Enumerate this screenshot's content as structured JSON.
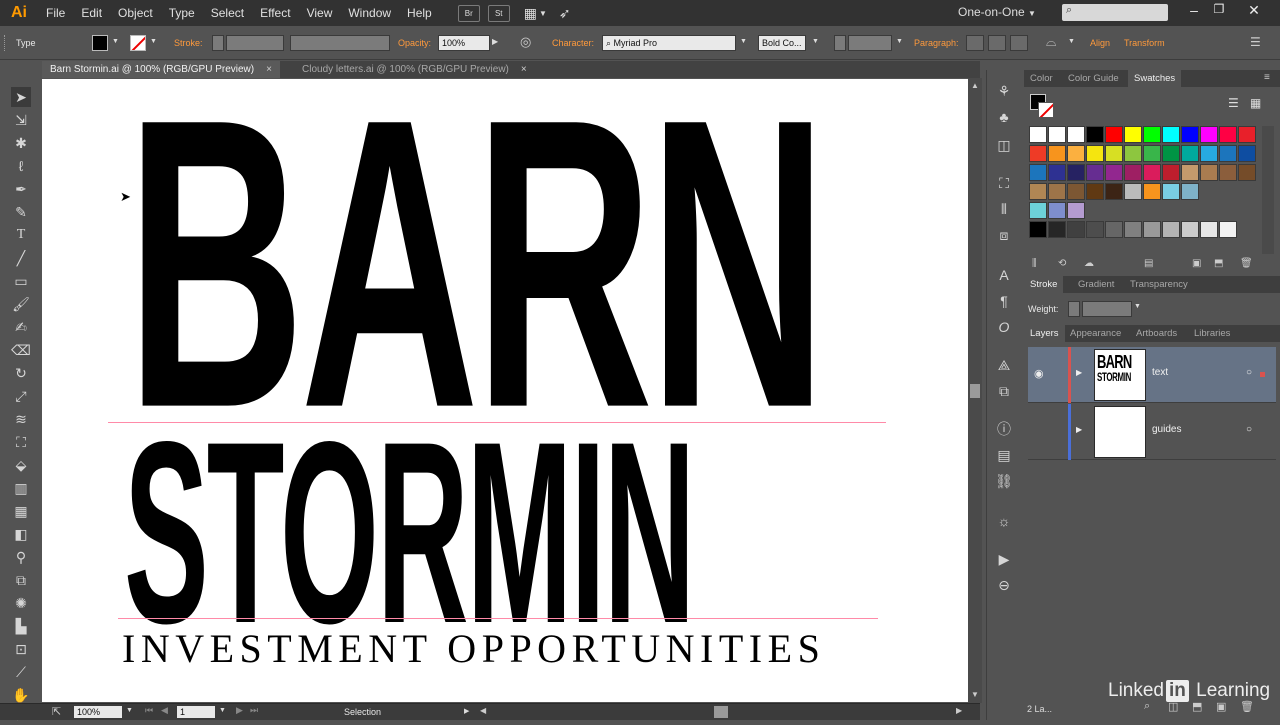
{
  "app": {
    "logo": "Ai",
    "menus": [
      "File",
      "Edit",
      "Object",
      "Type",
      "Select",
      "Effect",
      "View",
      "Window",
      "Help"
    ],
    "bridge_btn": "Br",
    "stock_btn": "St",
    "workspace": "One-on-One"
  },
  "control_bar": {
    "selection_type": "Type",
    "stroke_label": "Stroke:",
    "opacity_label": "Opacity:",
    "opacity_value": "100%",
    "character_label": "Character:",
    "font_family": "Myriad Pro",
    "font_style": "Bold Co...",
    "paragraph_label": "Paragraph:",
    "align_label": "Align",
    "transform_label": "Transform"
  },
  "tabs": [
    {
      "label": "Barn Stormin.ai @ 100% (RGB/GPU Preview)",
      "close": "×"
    },
    {
      "label": "Cloudy letters.ai @ 100% (RGB/GPU Preview)",
      "close": "×"
    }
  ],
  "artwork": {
    "line1": "BARN",
    "line2": "STORMIN",
    "line3": "INVESTMENT OPPORTUNITIES"
  },
  "status_bar": {
    "zoom": "100%",
    "artboard_num": "1",
    "tool_name": "Selection"
  },
  "swatch_panel": {
    "tabs": [
      "Color",
      "Color Guide",
      "Swatches"
    ],
    "rows": [
      [
        "#ffffff",
        "#ffffff",
        "#ffffff",
        "#000000",
        "#ff0000",
        "#ffff00",
        "#00ff00",
        "#00ffff",
        "#0000ff",
        "#ff00ff",
        "#ff0044",
        "#e8202a"
      ],
      [
        "#ee3b26",
        "#f7941d",
        "#fbb040",
        "#f5e50f",
        "#d7df23",
        "#8dc63f",
        "#39b54a",
        "#009444",
        "#00a99d",
        "#27aae1",
        "#1c75bc",
        "#0e4da1"
      ],
      [
        "#1c75bc",
        "#2e3192",
        "#262262",
        "#662d91",
        "#92278f",
        "#9e1f63",
        "#da1c5c",
        "#be1e2d",
        "#c49a6c",
        "#a97c50",
        "#8b5e3c",
        "#754c29"
      ],
      [
        "#b08654",
        "#9d7449",
        "#7c5733",
        "#603913",
        "#3c2415",
        "#bbbbbb",
        "#f7941d",
        "#79cde3",
        "#7fb2c8"
      ],
      [
        "#6dd1d9",
        "#7e8ecd",
        "#b49bd0"
      ],
      [
        "#000000",
        "#262626",
        "#404040",
        "#4d4d4d",
        "#666666",
        "#808080",
        "#999999",
        "#b3b3b3",
        "#cccccc",
        "#e6e6e6",
        "#f2f2f2"
      ]
    ]
  },
  "stroke_panel": {
    "tabs": [
      "Stroke",
      "Gradient",
      "Transparency"
    ],
    "weight_label": "Weight:"
  },
  "layers_panel": {
    "tabs": [
      "Layers",
      "Appearance",
      "Artboards",
      "Libraries"
    ],
    "layers": [
      {
        "name": "text",
        "thumb_line1": "BARN",
        "thumb_line2": "STORMIN",
        "color": "#d9534f"
      },
      {
        "name": "guides",
        "thumb_line1": "",
        "thumb_line2": "",
        "color": "#4a6fd9"
      }
    ],
    "count_label": "2 La..."
  },
  "watermark": {
    "part1": "Linked",
    "part2": "in",
    "part3": " Learning"
  }
}
